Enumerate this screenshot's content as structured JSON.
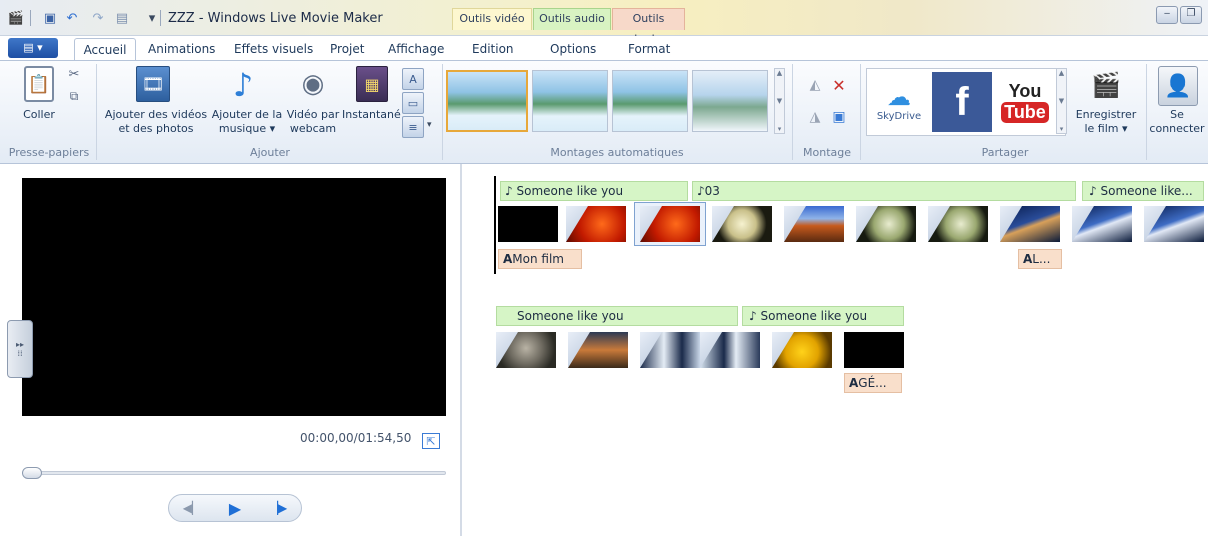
{
  "window": {
    "title": "ZZZ - Windows Live Movie Maker",
    "minimize": "‒",
    "restore": "❐"
  },
  "context_tabs": {
    "video": "Outils vidéo",
    "audio": "Outils audio",
    "text": "Outils texte"
  },
  "tabs": [
    "Accueil",
    "Animations",
    "Effets visuels",
    "Projet",
    "Affichage",
    "Edition",
    "Options",
    "Format"
  ],
  "ribbon": {
    "paste": "Coller",
    "add_videos": [
      "Ajouter des vidéos",
      "et des photos"
    ],
    "add_music": [
      "Ajouter de la",
      "musique ▾"
    ],
    "webcam": [
      "Vidéo par",
      "webcam"
    ],
    "snapshot": "Instantané",
    "groups": {
      "clipboard": "Presse-papiers",
      "add": "Ajouter",
      "automovie": "Montages automatiques",
      "edit": "Montage",
      "share": "Partager"
    },
    "skydrive": "SkyDrive",
    "youtube": [
      "You",
      "Tube"
    ],
    "save_movie": [
      "Enregistrer",
      "le film ▾"
    ],
    "sign_in": [
      "Se",
      "connecter"
    ]
  },
  "preview": {
    "time": "00:00,00/01:54,50"
  },
  "storyboard": {
    "row1_audio": [
      {
        "label": "Someone like you",
        "icon": true
      },
      {
        "label": "03",
        "icon": true
      },
      {
        "label": "Someone like...",
        "icon": true
      }
    ],
    "row1_text": [
      {
        "label": "Mon film"
      },
      {
        "label": "L..."
      }
    ],
    "row2_audio": [
      {
        "label": "Someone like you",
        "icon": false
      },
      {
        "label": "Someone like you",
        "icon": true
      }
    ],
    "row2_text": [
      {
        "label": "GÉ..."
      }
    ]
  },
  "colors": {
    "accent": "#1e4fa3",
    "audio_bar": "#d6f5c6",
    "text_bar": "#f9dfcb"
  }
}
